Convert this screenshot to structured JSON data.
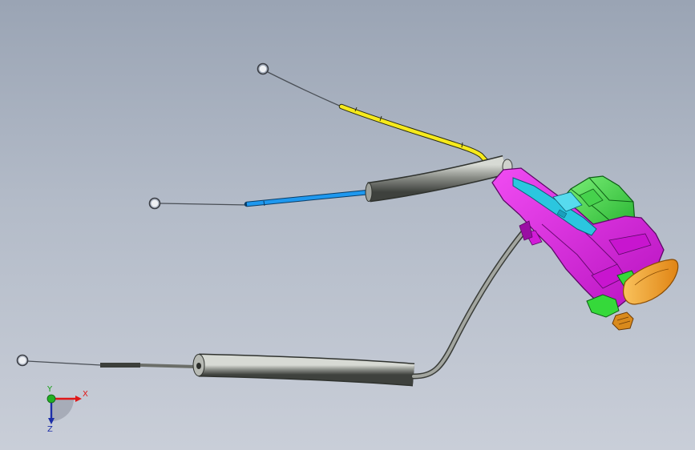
{
  "viewport": {
    "background_top": "#9aa4b4",
    "background_bottom": "#c9ced8"
  },
  "model": {
    "assembly": "cable-lock-actuator",
    "colors": {
      "housing": "#e21de6",
      "housing_dark": "#9a0fa3",
      "actuator": "#35d93a",
      "linkage": "#2bc6df",
      "release_handle": "#f5a623",
      "connector": "#d98a1c",
      "cable_upper": "#f6ea1c",
      "cable_middle": "#1e98ef",
      "sheath": "#8a8d88",
      "wire": "#4a4f56"
    }
  },
  "triad": {
    "x_label": "X",
    "y_label": "Y",
    "z_label": "Z",
    "x_color": "#e01818",
    "y_color": "#15a015",
    "z_color": "#1c2ea8"
  }
}
